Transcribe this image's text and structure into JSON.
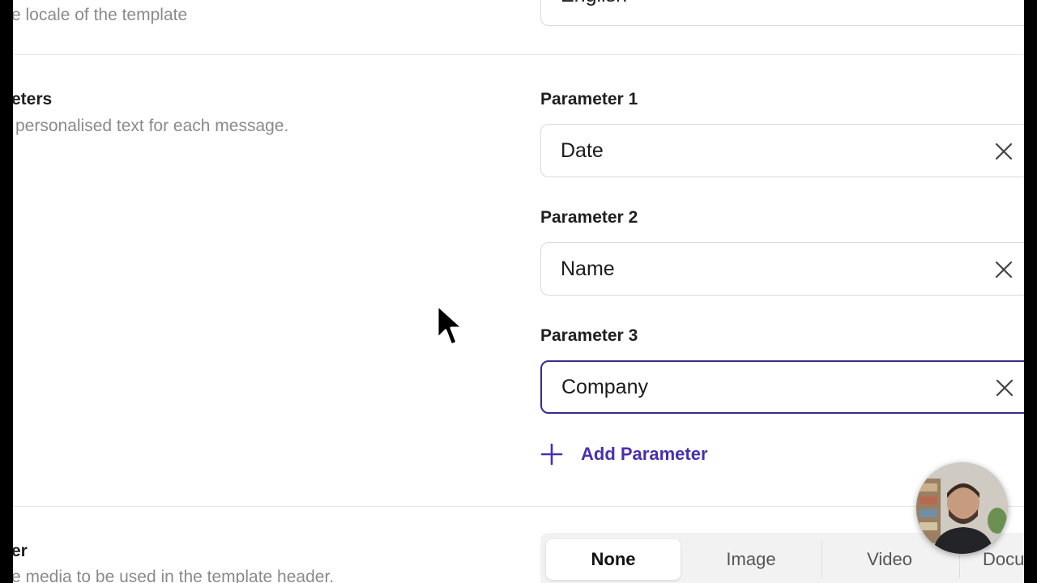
{
  "locale_section": {
    "description": "e locale of the template",
    "selected_value": "English"
  },
  "parameters_section": {
    "title": "eters",
    "description": "personalised text for each message.",
    "fields": [
      {
        "label": "Parameter 1",
        "value": "Date"
      },
      {
        "label": "Parameter 2",
        "value": "Name"
      },
      {
        "label": "Parameter 3",
        "value": "Company"
      }
    ],
    "add_label": "Add Parameter"
  },
  "header_section": {
    "title": "er",
    "description": "e media to be used in the template header.",
    "options": [
      "None",
      "Image",
      "Video",
      "Docu"
    ],
    "selected": "None"
  },
  "colors": {
    "accent": "#4a2fb0",
    "focus_border": "#3b2a8a",
    "muted_text": "#8a8a8a"
  },
  "icons": {
    "clear": "close-icon",
    "add": "plus-icon",
    "pointer": "mouse-cursor-icon"
  }
}
